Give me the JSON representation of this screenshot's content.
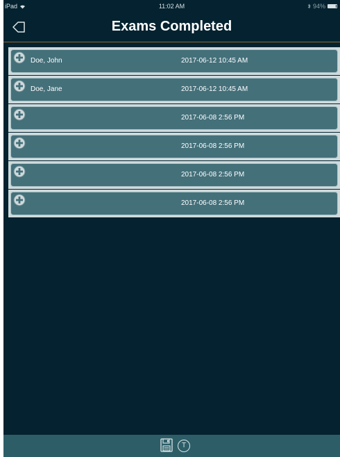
{
  "status_bar": {
    "device": "iPad",
    "time": "11:02 AM",
    "battery": "94%"
  },
  "header": {
    "title": "Exams Completed",
    "back_icon": "back-arrow-icon"
  },
  "exams": [
    {
      "name": "Doe, John",
      "date": "2017-06-12 10:45 AM"
    },
    {
      "name": "Doe, Jane",
      "date": "2017-06-12 10:45 AM"
    },
    {
      "name": "",
      "date": "2017-06-08 2:56 PM"
    },
    {
      "name": "",
      "date": "2017-06-08 2:56 PM"
    },
    {
      "name": "",
      "date": "2017-06-08 2:56 PM"
    },
    {
      "name": "",
      "date": "2017-06-08 2:56 PM"
    }
  ],
  "toolbar": {
    "save_icon": "save-icon",
    "text_glyph": "T"
  },
  "colors": {
    "background": "#04222f",
    "row": "#44707a",
    "toolbar": "#2d5e68",
    "divider": "#8f6a35"
  }
}
